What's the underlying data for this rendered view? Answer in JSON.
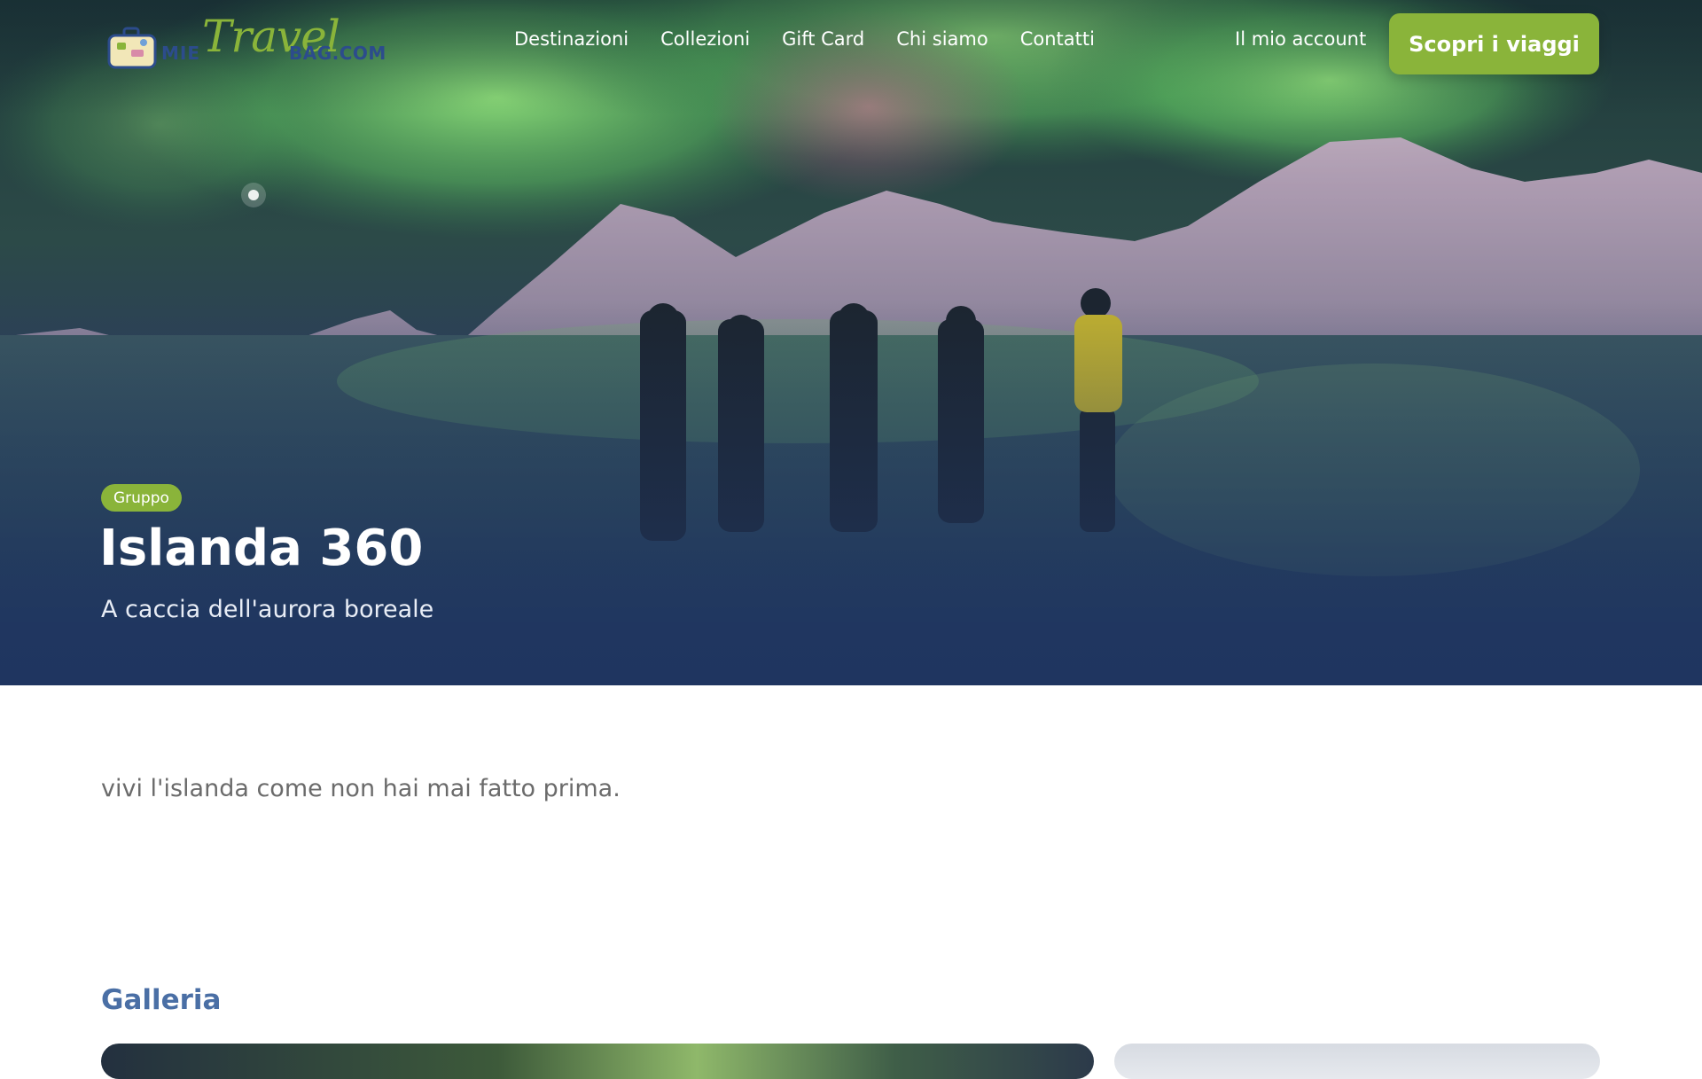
{
  "brand": {
    "logo_prefix": "MIE",
    "logo_script": "Travel",
    "logo_suffix": "BAG.COM"
  },
  "nav": {
    "links": [
      {
        "label": "Destinazioni"
      },
      {
        "label": "Collezioni"
      },
      {
        "label": "Gift Card"
      },
      {
        "label": "Chi siamo"
      },
      {
        "label": "Contatti"
      }
    ],
    "account": "Il mio account",
    "cta": "Scopri i viaggi"
  },
  "hero": {
    "badge": "Gruppo",
    "title": "Islanda 360",
    "subtitle": "A caccia dell'aurora boreale"
  },
  "content": {
    "intro": "vivi l'islanda come non hai mai fatto prima."
  },
  "gallery": {
    "title": "Galleria"
  },
  "colors": {
    "accent": "#8ab43a",
    "navy": "#1f3560",
    "heading_blue": "#4a6fa5"
  }
}
